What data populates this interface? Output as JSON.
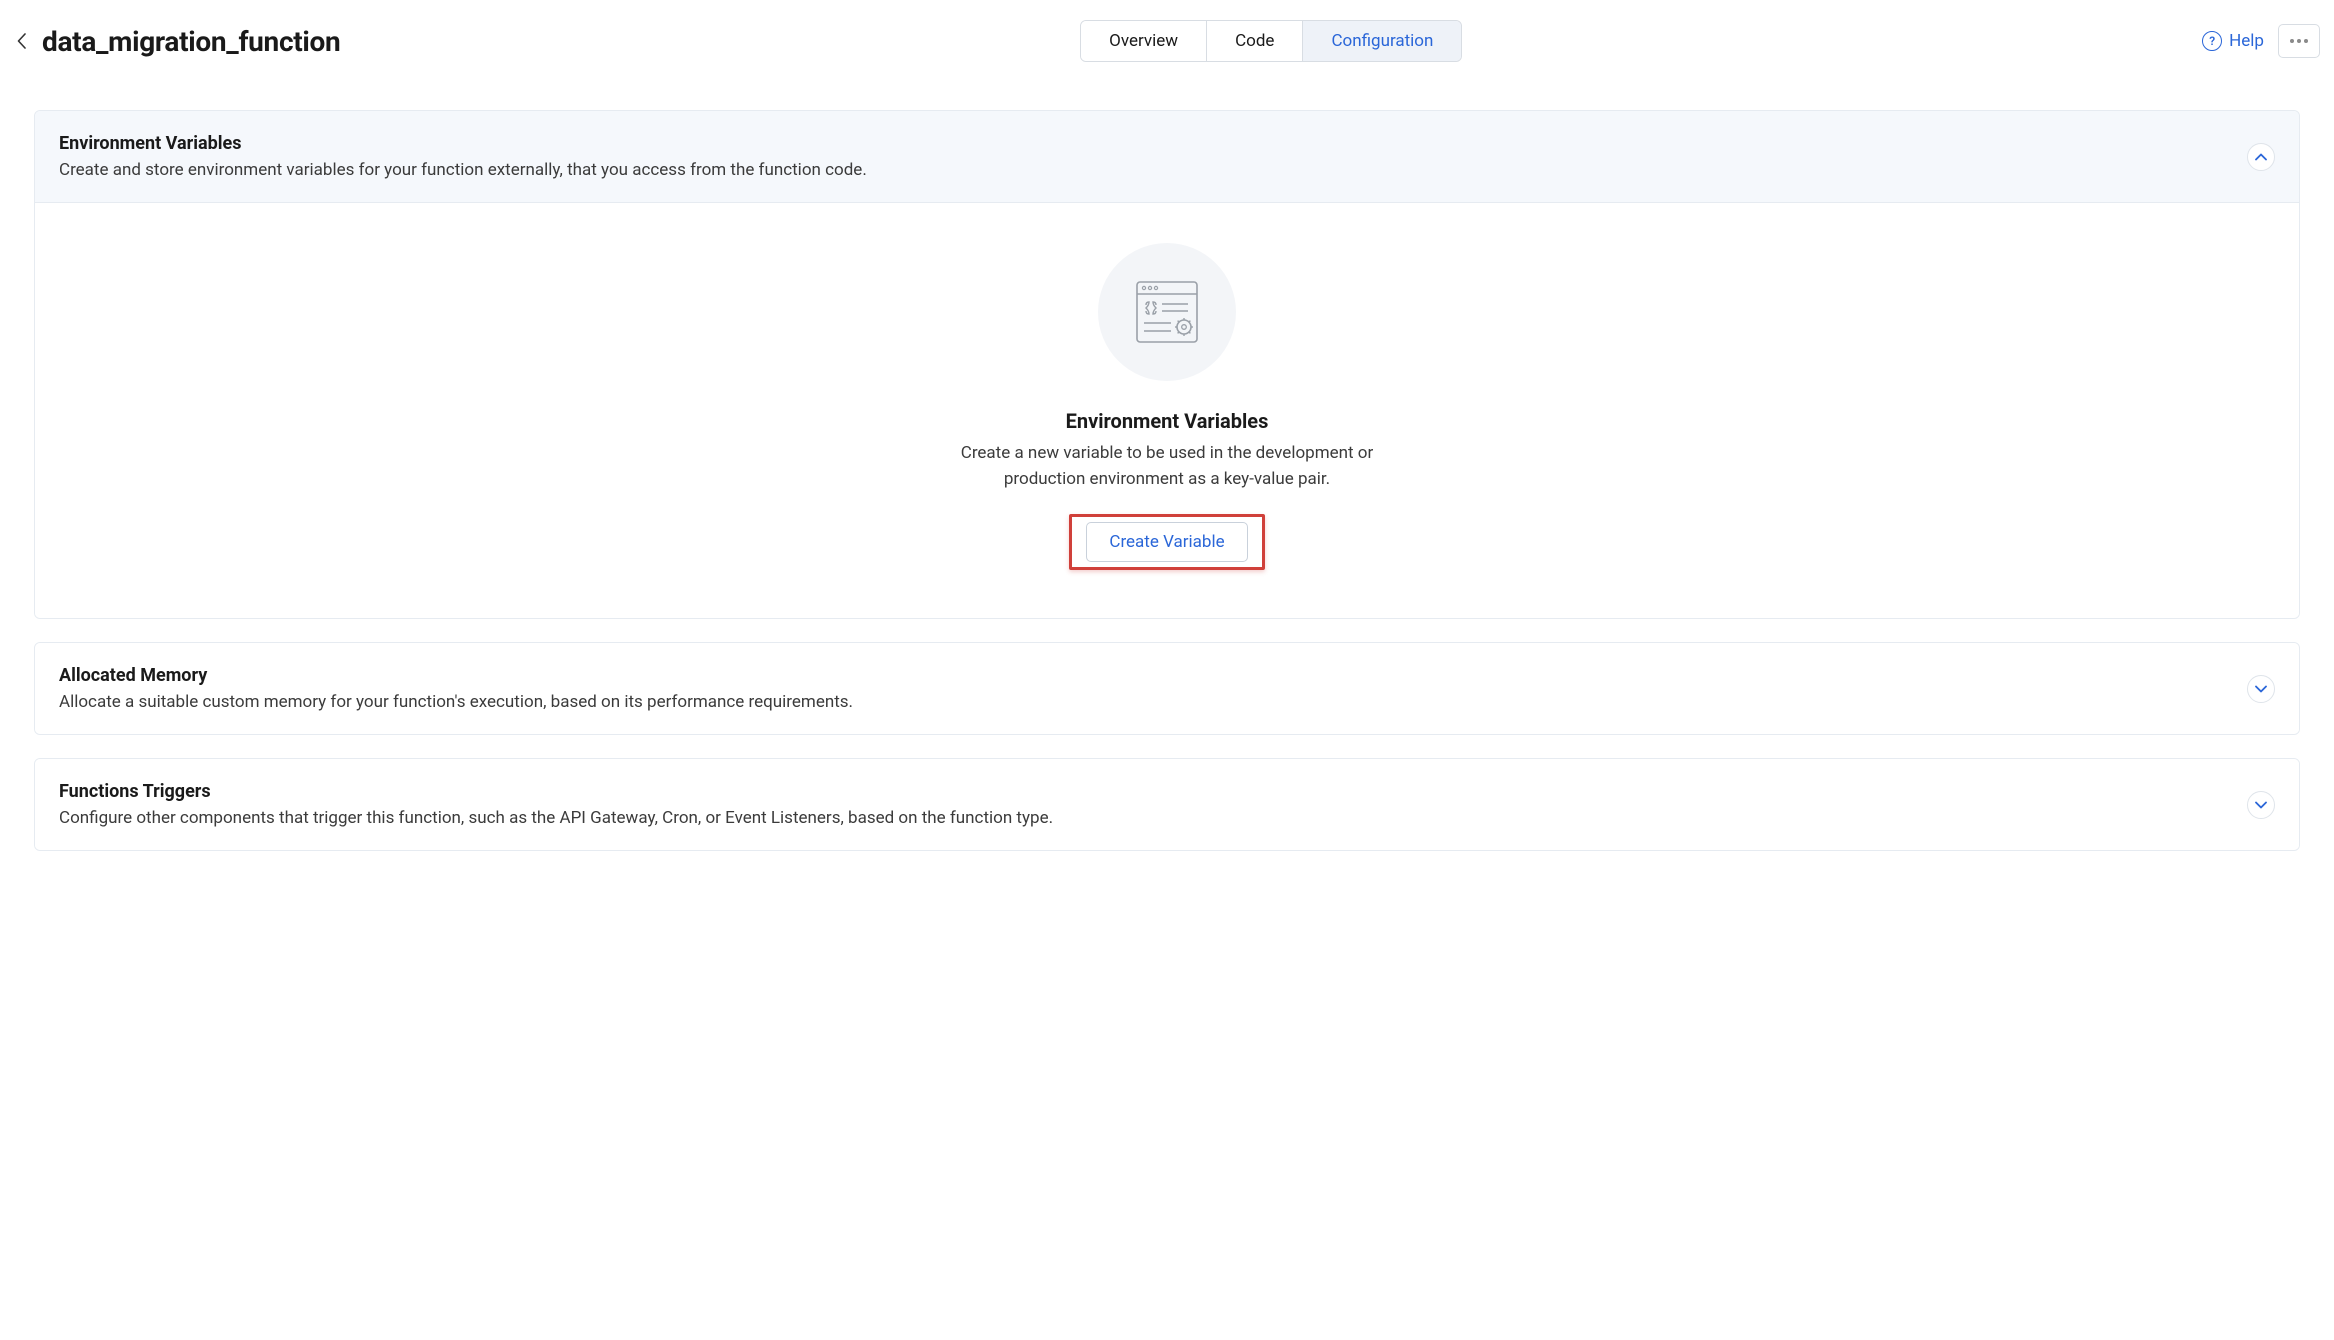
{
  "header": {
    "page_title": "data_migration_function",
    "tabs": {
      "overview": "Overview",
      "code": "Code",
      "configuration": "Configuration"
    },
    "help_label": "Help"
  },
  "panels": {
    "env": {
      "title": "Environment Variables",
      "subtitle": "Create and store environment variables for your function externally, that you access from the function code.",
      "empty": {
        "heading": "Environment Variables",
        "subtitle": "Create a new variable to be used in the development or production environment as a key-value pair.",
        "button_label": "Create Variable"
      }
    },
    "memory": {
      "title": "Allocated Memory",
      "subtitle": "Allocate a suitable custom memory for your function's execution, based on its performance requirements."
    },
    "triggers": {
      "title": "Functions Triggers",
      "subtitle": "Configure other components that trigger this function, such as the API Gateway, Cron, or Event Listeners, based on the function type."
    }
  }
}
